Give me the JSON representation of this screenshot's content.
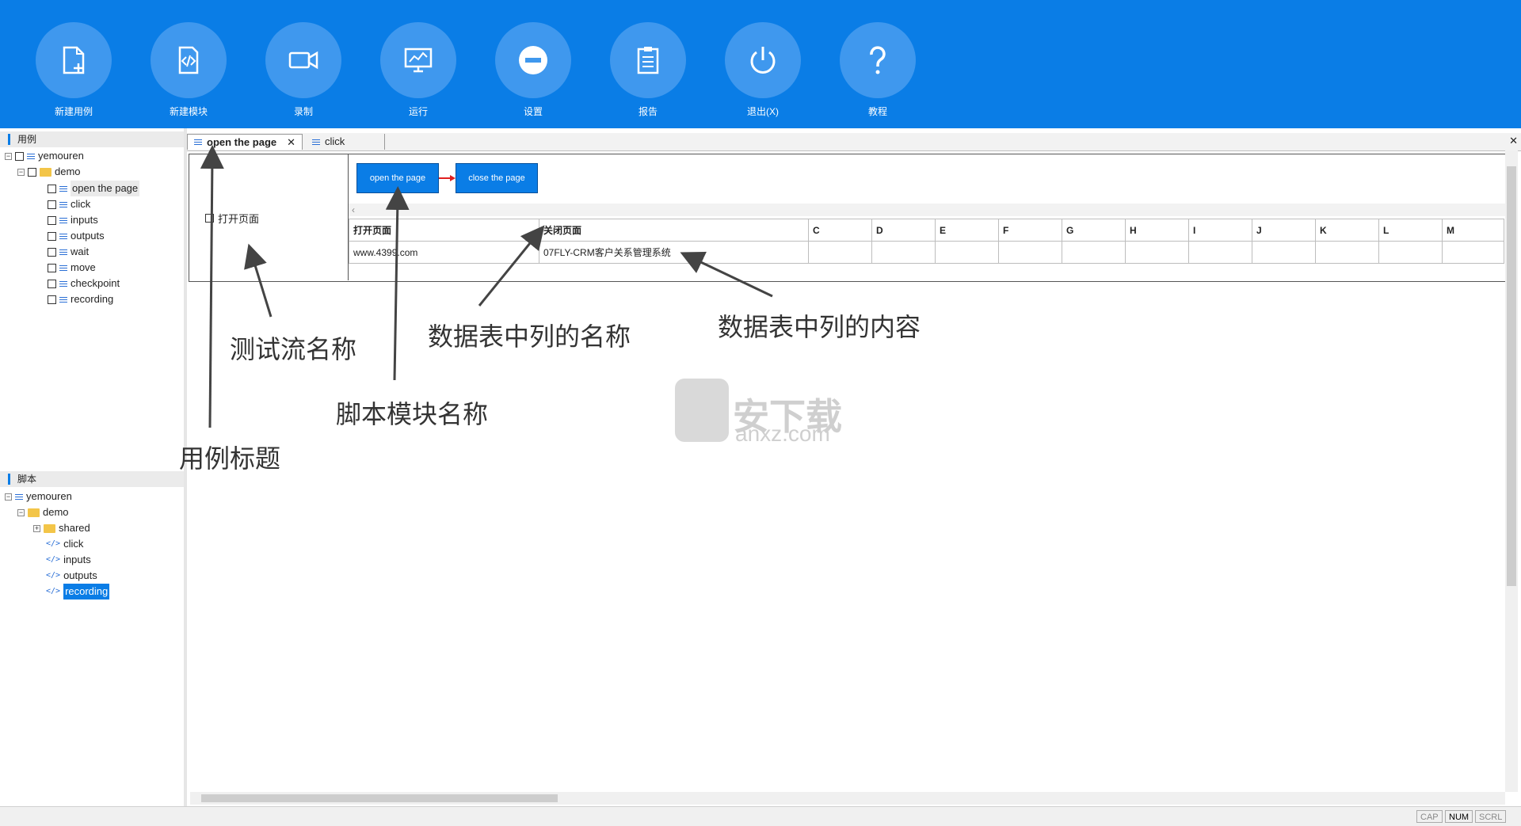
{
  "toolbar": {
    "buttons": [
      {
        "label": "新建用例",
        "icon": "new-case-icon"
      },
      {
        "label": "新建模块",
        "icon": "code-module-icon"
      },
      {
        "label": "录制",
        "icon": "video-camera-icon"
      },
      {
        "label": "运行",
        "icon": "monitor-run-icon"
      },
      {
        "label": "设置",
        "icon": "settings-minus-icon"
      },
      {
        "label": "报告",
        "icon": "clipboard-report-icon"
      },
      {
        "label": "退出(X)",
        "icon": "power-icon"
      },
      {
        "label": "教程",
        "icon": "question-icon"
      }
    ]
  },
  "cases_panel": {
    "title": "用例",
    "root": "yemouren",
    "folder": "demo",
    "items": [
      "open the page",
      "click",
      "inputs",
      "outputs",
      "wait",
      "move",
      "checkpoint",
      "recording"
    ]
  },
  "scripts_panel": {
    "title": "脚本",
    "root": "yemouren",
    "folder": "demo",
    "subfolder": "shared",
    "items": [
      "click",
      "inputs",
      "outputs",
      "recording"
    ]
  },
  "tabs": [
    {
      "label": "open the page",
      "active": true
    },
    {
      "label": "click",
      "active": false
    }
  ],
  "flow": {
    "name": "打开页面",
    "nodes": [
      "open the page",
      "close the page"
    ]
  },
  "datatable": {
    "columns": [
      "打开页面",
      "关闭页面",
      "C",
      "D",
      "E",
      "F",
      "G",
      "H",
      "I",
      "J",
      "K",
      "L",
      "M"
    ],
    "row": [
      "www.4399.com",
      "07FLY-CRM客户关系管理系统",
      "",
      "",
      "",
      "",
      "",
      "",
      "",
      "",
      "",
      "",
      ""
    ]
  },
  "annotations": {
    "flow_name": "测试流名称",
    "col_name": "数据表中列的名称",
    "col_content": "数据表中列的内容",
    "module_name": "脚本模块名称",
    "case_title": "用例标题"
  },
  "watermark": {
    "text_cn": "安下载",
    "text_en": "anxz.com"
  },
  "status": {
    "cap": "CAP",
    "num": "NUM",
    "scrl": "SCRL"
  },
  "colors": {
    "accent": "#0a7de6",
    "selected": "#0a7de6"
  }
}
